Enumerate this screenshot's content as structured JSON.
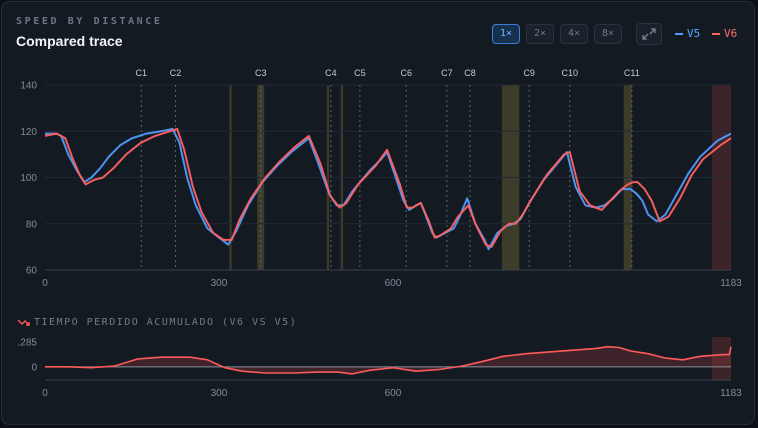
{
  "header": {
    "overline": "SPEED BY DISTANCE",
    "title": "Compared trace"
  },
  "controls": {
    "zoom_options": [
      "1×",
      "2×",
      "4×",
      "8×"
    ],
    "active_zoom": "1×",
    "expand_icon": "expand-icon"
  },
  "colors": {
    "v5": "#4f9bff",
    "v6": "#ff6161",
    "marker": "#5c6470",
    "band_amber": "#8a7a3a",
    "band_red": "#a03a3a",
    "delta": "#ff5a5a"
  },
  "chart_data": [
    {
      "type": "line",
      "title": "SPEED BY DISTANCE",
      "subtitle": "Compared trace",
      "xlim": [
        0,
        1183
      ],
      "ylim": [
        60,
        140
      ],
      "x_ticks": [
        0,
        300,
        600,
        1183
      ],
      "y_ticks": [
        60,
        80,
        100,
        120,
        140
      ],
      "legend_position": "top-right",
      "markers": [
        {
          "label": "C1",
          "x": 166
        },
        {
          "label": "C2",
          "x": 225
        },
        {
          "label": "C3",
          "x": 372
        },
        {
          "label": "C4",
          "x": 493
        },
        {
          "label": "C5",
          "x": 543
        },
        {
          "label": "C6",
          "x": 623
        },
        {
          "label": "C7",
          "x": 693
        },
        {
          "label": "C8",
          "x": 733
        },
        {
          "label": "C9",
          "x": 835
        },
        {
          "label": "C10",
          "x": 905
        },
        {
          "label": "C11",
          "x": 1012
        }
      ],
      "bands": [
        {
          "from": 318,
          "to": 322,
          "tone": "amber"
        },
        {
          "from": 366,
          "to": 378,
          "tone": "amber"
        },
        {
          "from": 486,
          "to": 490,
          "tone": "amber"
        },
        {
          "from": 510,
          "to": 514,
          "tone": "amber"
        },
        {
          "from": 788,
          "to": 818,
          "tone": "amber"
        },
        {
          "from": 998,
          "to": 1012,
          "tone": "amber"
        },
        {
          "from": 1150,
          "to": 1183,
          "tone": "red"
        }
      ],
      "series": [
        {
          "name": "V5",
          "points": [
            [
              0,
              119
            ],
            [
              20,
              119
            ],
            [
              28,
              118
            ],
            [
              40,
              110
            ],
            [
              55,
              103
            ],
            [
              68,
              98
            ],
            [
              80,
              100
            ],
            [
              95,
              104
            ],
            [
              110,
              109
            ],
            [
              130,
              114
            ],
            [
              150,
              117
            ],
            [
              175,
              119
            ],
            [
              200,
              120
            ],
            [
              220,
              121
            ],
            [
              232,
              115
            ],
            [
              245,
              100
            ],
            [
              260,
              88
            ],
            [
              280,
              78
            ],
            [
              300,
              74
            ],
            [
              316,
              71
            ],
            [
              330,
              77
            ],
            [
              350,
              88
            ],
            [
              375,
              98
            ],
            [
              400,
              105
            ],
            [
              425,
              111
            ],
            [
              450,
              116
            ],
            [
              455,
              117
            ],
            [
              470,
              107
            ],
            [
              490,
              93
            ],
            [
              503,
              88
            ],
            [
              515,
              88
            ],
            [
              530,
              94
            ],
            [
              560,
              103
            ],
            [
              580,
              108
            ],
            [
              590,
              111
            ],
            [
              605,
              100
            ],
            [
              618,
              90
            ],
            [
              628,
              86
            ],
            [
              640,
              88
            ],
            [
              648,
              89
            ],
            [
              656,
              84
            ],
            [
              668,
              76
            ],
            [
              675,
              74
            ],
            [
              690,
              76
            ],
            [
              705,
              78
            ],
            [
              715,
              83
            ],
            [
              728,
              91
            ],
            [
              742,
              80
            ],
            [
              758,
              73
            ],
            [
              765,
              69
            ],
            [
              780,
              76
            ],
            [
              795,
              79
            ],
            [
              808,
              80
            ],
            [
              820,
              82
            ],
            [
              835,
              89
            ],
            [
              860,
              99
            ],
            [
              890,
              108
            ],
            [
              900,
              111
            ],
            [
              915,
              96
            ],
            [
              932,
              88
            ],
            [
              950,
              87
            ],
            [
              965,
              88
            ],
            [
              980,
              91
            ],
            [
              995,
              95
            ],
            [
              1010,
              95
            ],
            [
              1020,
              93
            ],
            [
              1030,
              90
            ],
            [
              1040,
              84
            ],
            [
              1055,
              81
            ],
            [
              1070,
              84
            ],
            [
              1090,
              93
            ],
            [
              1110,
              102
            ],
            [
              1130,
              109
            ],
            [
              1160,
              116
            ],
            [
              1183,
              119
            ]
          ]
        },
        {
          "name": "V6",
          "points": [
            [
              0,
              118
            ],
            [
              20,
              119
            ],
            [
              35,
              117
            ],
            [
              48,
              108
            ],
            [
              60,
              101
            ],
            [
              70,
              97
            ],
            [
              85,
              99
            ],
            [
              100,
              100
            ],
            [
              118,
              104
            ],
            [
              140,
              110
            ],
            [
              165,
              115
            ],
            [
              190,
              118
            ],
            [
              215,
              120
            ],
            [
              228,
              121
            ],
            [
              240,
              112
            ],
            [
              255,
              96
            ],
            [
              270,
              85
            ],
            [
              290,
              76
            ],
            [
              308,
              73
            ],
            [
              322,
              73
            ],
            [
              336,
              82
            ],
            [
              355,
              91
            ],
            [
              380,
              100
            ],
            [
              405,
              107
            ],
            [
              430,
              113
            ],
            [
              455,
              118
            ],
            [
              475,
              106
            ],
            [
              492,
              92
            ],
            [
              508,
              87
            ],
            [
              520,
              89
            ],
            [
              540,
              97
            ],
            [
              570,
              105
            ],
            [
              590,
              112
            ],
            [
              612,
              97
            ],
            [
              624,
              87
            ],
            [
              634,
              87
            ],
            [
              648,
              89
            ],
            [
              662,
              81
            ],
            [
              672,
              74
            ],
            [
              682,
              75
            ],
            [
              700,
              78
            ],
            [
              712,
              83
            ],
            [
              730,
              88
            ],
            [
              744,
              79
            ],
            [
              760,
              71
            ],
            [
              770,
              70
            ],
            [
              786,
              77
            ],
            [
              800,
              80
            ],
            [
              812,
              80
            ],
            [
              824,
              84
            ],
            [
              840,
              91
            ],
            [
              865,
              101
            ],
            [
              895,
              110
            ],
            [
              905,
              111
            ],
            [
              922,
              94
            ],
            [
              940,
              88
            ],
            [
              960,
              86
            ],
            [
              975,
              90
            ],
            [
              990,
              94
            ],
            [
              1005,
              97
            ],
            [
              1015,
              98
            ],
            [
              1022,
              98
            ],
            [
              1034,
              95
            ],
            [
              1046,
              90
            ],
            [
              1060,
              81
            ],
            [
              1075,
              83
            ],
            [
              1095,
              91
            ],
            [
              1115,
              101
            ],
            [
              1135,
              108
            ],
            [
              1165,
              114
            ],
            [
              1183,
              117
            ]
          ]
        }
      ]
    },
    {
      "type": "area",
      "title": "TIEMPO PERDIDO ACUMULADO (V6 VS V5)",
      "xlim": [
        0,
        1183
      ],
      "ylim": [
        -0.15,
        0.34
      ],
      "x_ticks": [
        0,
        300,
        600,
        1183
      ],
      "y_tick_labels": [
        ".285",
        "0"
      ],
      "y_tick_values": [
        0.285,
        0
      ],
      "band": {
        "from": 1150,
        "to": 1183,
        "tone": "red"
      },
      "series": [
        {
          "name": "V6 vs V5",
          "points": [
            [
              0,
              0
            ],
            [
              40,
              0
            ],
            [
              80,
              -0.01
            ],
            [
              120,
              0.01
            ],
            [
              160,
              0.09
            ],
            [
              200,
              0.11
            ],
            [
              250,
              0.11
            ],
            [
              280,
              0.08
            ],
            [
              310,
              -0.01
            ],
            [
              340,
              -0.05
            ],
            [
              380,
              -0.07
            ],
            [
              430,
              -0.07
            ],
            [
              470,
              -0.06
            ],
            [
              505,
              -0.06
            ],
            [
              530,
              -0.08
            ],
            [
              560,
              -0.04
            ],
            [
              600,
              -0.01
            ],
            [
              640,
              -0.05
            ],
            [
              680,
              -0.03
            ],
            [
              720,
              0.01
            ],
            [
              760,
              0.07
            ],
            [
              790,
              0.12
            ],
            [
              830,
              0.15
            ],
            [
              870,
              0.17
            ],
            [
              910,
              0.19
            ],
            [
              950,
              0.21
            ],
            [
              970,
              0.23
            ],
            [
              990,
              0.22
            ],
            [
              1010,
              0.18
            ],
            [
              1040,
              0.15
            ],
            [
              1070,
              0.1
            ],
            [
              1100,
              0.08
            ],
            [
              1130,
              0.12
            ],
            [
              1170,
              0.14
            ],
            [
              1180,
              0.14
            ],
            [
              1183,
              0.23
            ]
          ]
        }
      ]
    }
  ]
}
